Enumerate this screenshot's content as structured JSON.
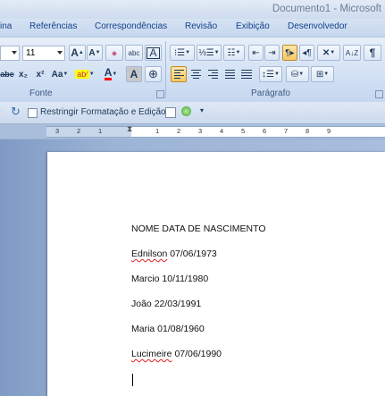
{
  "window": {
    "title": "Documento1 - Microsoft"
  },
  "tabs": [
    {
      "label": "ina"
    },
    {
      "label": "Referências"
    },
    {
      "label": "Correspondências"
    },
    {
      "label": "Revisão"
    },
    {
      "label": "Exibição"
    },
    {
      "label": "Desenvolvedor"
    }
  ],
  "ribbon": {
    "font_group_label": "Fonte",
    "paragraph_group_label": "Parágrafo",
    "font_size": "11",
    "grow_font": "A",
    "shrink_font": "A",
    "clear_format": "Aa",
    "char_spacing": "abc",
    "char_border": "A",
    "strikethrough": "abe",
    "subscript": "x₂",
    "superscript": "x²",
    "change_case": "Aa",
    "font_color_letter": "A",
    "char_shading_letter": "A",
    "sort_label": "A↓Z",
    "pilcrow": "¶"
  },
  "quick_access": {
    "restrict_label": "Restringir Formatação e Edição"
  },
  "ruler": {
    "numbers": [
      "3",
      "2",
      "1",
      "1",
      "2",
      "3",
      "4",
      "5",
      "6",
      "7",
      "8",
      "9"
    ]
  },
  "document": {
    "lines": [
      {
        "name": "NOME",
        "rest": " DATA DE NASCIMENTO",
        "misspelled": false
      },
      {
        "name": "Ednilson",
        "rest": " 07/06/1973",
        "misspelled": true
      },
      {
        "name": "Marcio",
        "rest": " 10/11/1980",
        "misspelled": false
      },
      {
        "name": "João",
        "rest": " 22/03/1991",
        "misspelled": false
      },
      {
        "name": "Maria",
        "rest": " 01/08/1960",
        "misspelled": false
      },
      {
        "name": "Lucimeire",
        "rest": " 07/06/1990",
        "misspelled": true
      }
    ]
  },
  "colors": {
    "highlight": "#ffff00",
    "font_color": "#ff0000",
    "misspelling": "#e02020"
  }
}
